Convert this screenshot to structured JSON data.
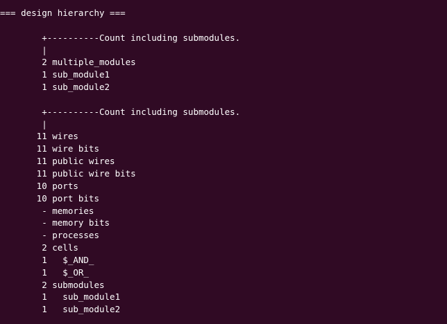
{
  "terminal": {
    "lines": [
      "=== design hierarchy ===",
      "",
      "        +----------Count including submodules.",
      "        |",
      "        2 multiple_modules",
      "        1 sub_module1",
      "        1 sub_module2",
      "",
      "        +----------Count including submodules.",
      "        |",
      "       11 wires",
      "       11 wire bits",
      "       11 public wires",
      "       11 public wire bits",
      "       10 ports",
      "       10 port bits",
      "        - memories",
      "        - memory bits",
      "        - processes",
      "        2 cells",
      "        1   $_AND_",
      "        1   $_OR_",
      "        2 submodules",
      "        1   sub_module1",
      "        1   sub_module2"
    ]
  }
}
